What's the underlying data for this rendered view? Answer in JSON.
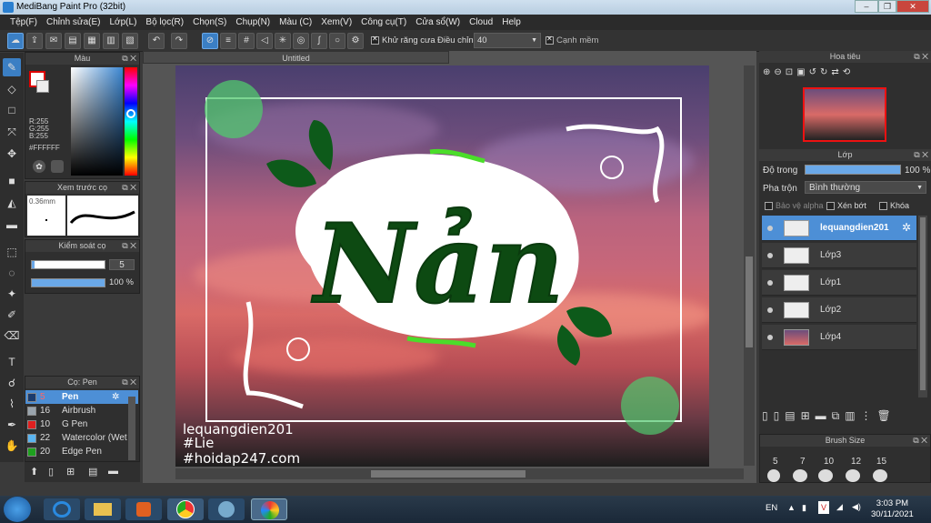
{
  "window": {
    "title": "MediBang Paint Pro (32bit)"
  },
  "menu": [
    "Tệp(F)",
    "Chỉnh sửa(E)",
    "Lớp(L)",
    "Bộ lọc(R)",
    "Chọn(S)",
    "Chụp(N)",
    "Màu (C)",
    "Xem(V)",
    "Công cụ(T)",
    "Cửa sổ(W)",
    "Cloud",
    "Help"
  ],
  "toolbar": {
    "antialias_label": "Khử răng cưa",
    "adjust_label": "Điều chỉnh",
    "adjust_value": "40",
    "sharp_edge_label": "Cạnh mềm"
  },
  "color_panel": {
    "title": "Màu",
    "r": "R:255",
    "g": "G:255",
    "b": "B:255",
    "hex": "#FFFFFF"
  },
  "brush_preview": {
    "title": "Xem trước cọ",
    "size": "0.36mm"
  },
  "brush_control": {
    "title": "Kiểm soát cọ",
    "size": "5",
    "opacity": "100 %"
  },
  "brush_list": {
    "title": "Cọ: Pen",
    "items": [
      {
        "size": "5",
        "name": "Pen",
        "color": "#1a3b6e"
      },
      {
        "size": "16",
        "name": "Airbrush",
        "color": "#9aa4ad"
      },
      {
        "size": "10",
        "name": "G Pen",
        "color": "#e02020"
      },
      {
        "size": "22",
        "name": "Watercolor (Wet",
        "color": "#5ab4f0"
      },
      {
        "size": "20",
        "name": "Edge Pen",
        "color": "#1ea01e"
      }
    ]
  },
  "document": {
    "tab": "Untitled",
    "artwork_title": "Nản",
    "watermark": [
      "lequangdien201",
      "#Lie",
      "#hoidap247.com"
    ]
  },
  "navigator": {
    "title": "Hoa tiêu"
  },
  "layers": {
    "title": "Lớp",
    "opacity_label": "Độ trong",
    "opacity_value": "100 %",
    "blend_label": "Pha trộn",
    "blend_value": "Bình thường",
    "alpha_label": "Bảo vệ alpha",
    "clip_label": "Xén bớt",
    "lock_label": "Khóa",
    "items": [
      "lequangdien201",
      "Lớp3",
      "Lớp1",
      "Lớp2",
      "Lớp4"
    ]
  },
  "brush_size": {
    "title": "Brush Size",
    "values": [
      "5",
      "7",
      "10",
      "12",
      "15"
    ]
  },
  "taskbar": {
    "lang": "EN",
    "time": "3:03 PM",
    "date": "30/11/2021"
  }
}
